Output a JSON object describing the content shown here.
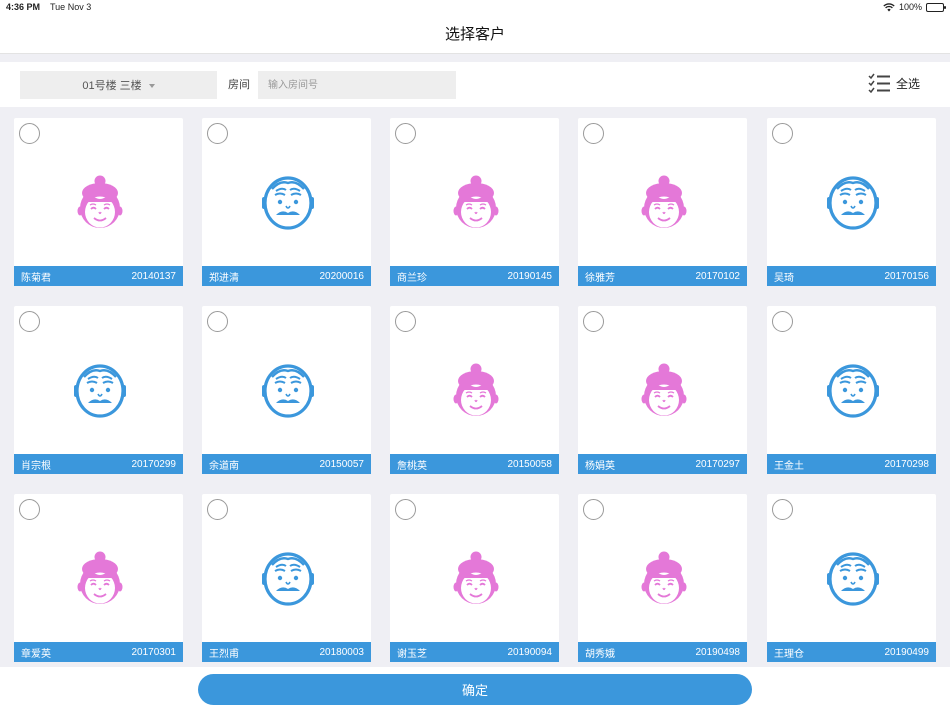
{
  "status_bar": {
    "time": "4:36 PM",
    "date": "Tue Nov 3",
    "battery": "100%",
    "battery_level": 1.0
  },
  "nav": {
    "title": "选择客户"
  },
  "filters": {
    "building": "01号楼 三楼",
    "room_label": "房间",
    "room_placeholder": "输入房间号",
    "select_all_label": "全选"
  },
  "customers": [
    {
      "name": "陈菊君",
      "id": "20140137",
      "gender": "female"
    },
    {
      "name": "郑进清",
      "id": "20200016",
      "gender": "male"
    },
    {
      "name": "商兰珍",
      "id": "20190145",
      "gender": "female"
    },
    {
      "name": "徐雅芳",
      "id": "20170102",
      "gender": "female"
    },
    {
      "name": "吴琦",
      "id": "20170156",
      "gender": "male"
    },
    {
      "name": "肖宗根",
      "id": "20170299",
      "gender": "male"
    },
    {
      "name": "余道南",
      "id": "20150057",
      "gender": "male"
    },
    {
      "name": "詹桃英",
      "id": "20150058",
      "gender": "female"
    },
    {
      "name": "杨娟英",
      "id": "20170297",
      "gender": "female"
    },
    {
      "name": "王金土",
      "id": "20170298",
      "gender": "male"
    },
    {
      "name": "章爱英",
      "id": "20170301",
      "gender": "female"
    },
    {
      "name": "王烈甫",
      "id": "20180003",
      "gender": "male"
    },
    {
      "name": "谢玉芝",
      "id": "20190094",
      "gender": "female"
    },
    {
      "name": "胡秀娥",
      "id": "20190498",
      "gender": "female"
    },
    {
      "name": "王理仓",
      "id": "20190499",
      "gender": "male"
    }
  ],
  "confirm_label": "确定",
  "colors": {
    "accent": "#3b97dc",
    "female_avatar": "#e478d8",
    "male_avatar": "#3b97dc"
  },
  "icons": {
    "female": "grandmother-avatar-icon",
    "male": "grandfather-avatar-icon",
    "select_all": "checklist-icon",
    "dropdown": "caret-down-icon",
    "wifi": "wifi-icon",
    "battery": "battery-icon"
  }
}
